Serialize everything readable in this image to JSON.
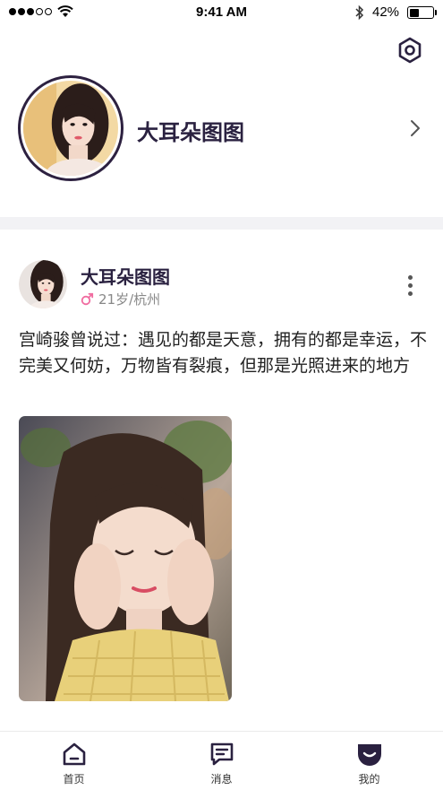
{
  "status_bar": {
    "time": "9:41 AM",
    "battery_percent": "42%",
    "battery_level": 0.42,
    "signal_bars_filled": 3,
    "signal_bars_total": 5
  },
  "profile": {
    "name": "大耳朵图图",
    "avatar_icon": "avatar-photo",
    "settings_icon": "hexagon-gear-icon"
  },
  "post": {
    "username": "大耳朵图图",
    "gender_icon": "male-symbol-icon",
    "meta": "21岁/杭州",
    "text": "宫崎骏曾说过：遇见的都是天意，拥有的都是幸运，不完美又何妨，万物皆有裂痕，但那是光照进来的地方"
  },
  "tabs": [
    {
      "label": "首页",
      "icon": "home-icon"
    },
    {
      "label": "消息",
      "icon": "message-icon"
    },
    {
      "label": "我的",
      "icon": "profile-smile-icon"
    }
  ],
  "colors": {
    "accent": "#2a2140",
    "gender": "#f06ca0",
    "divider": "#f2f2f5"
  }
}
